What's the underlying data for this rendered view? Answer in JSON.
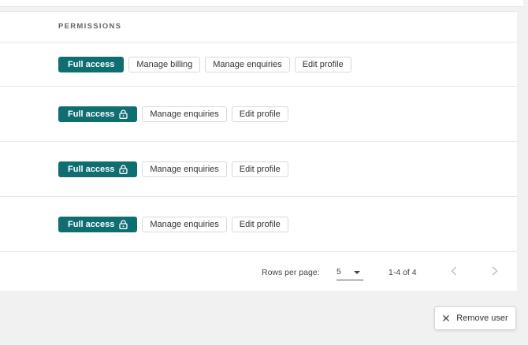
{
  "table": {
    "column_header": "PERMISSIONS",
    "rows": [
      {
        "chips": [
          "Full access",
          "Manage billing",
          "Manage enquiries",
          "Edit profile"
        ],
        "primary_locked": false
      },
      {
        "chips": [
          "Full access",
          "Manage enquiries",
          "Edit profile"
        ],
        "primary_locked": true
      },
      {
        "chips": [
          "Full access",
          "Manage enquiries",
          "Edit profile"
        ],
        "primary_locked": true
      },
      {
        "chips": [
          "Full access",
          "Manage enquiries",
          "Edit profile"
        ],
        "primary_locked": true
      }
    ]
  },
  "pagination": {
    "rows_per_page_label": "Rows per page:",
    "rows_per_page_value": "5",
    "range_label": "1-4 of 4"
  },
  "actions": {
    "remove_user_label": "Remove user"
  },
  "colors": {
    "primary_chip": "#0f6e72",
    "page_background": "#f1f1f1"
  },
  "icons": {
    "lock": "lock-icon",
    "dropdown": "chevron-down-icon",
    "prev": "chevron-left-icon",
    "next": "chevron-right-icon",
    "close": "close-icon"
  }
}
